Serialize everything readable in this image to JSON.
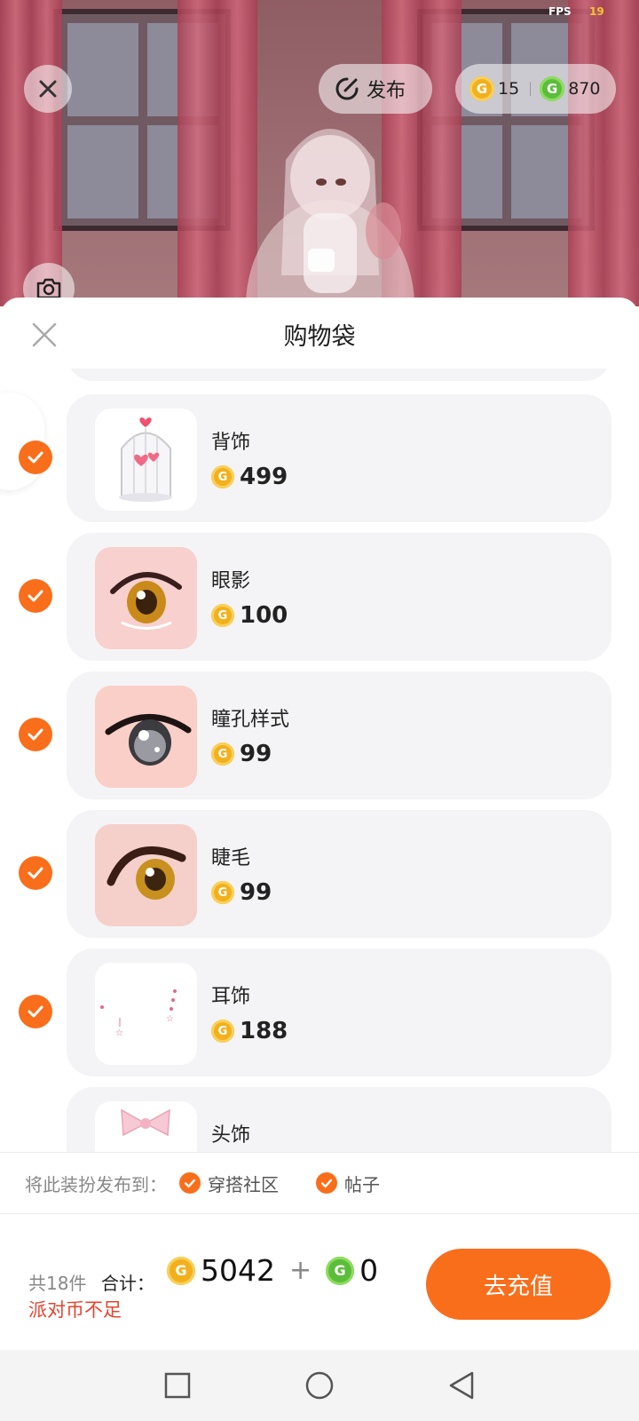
{
  "scene": {
    "fps_label": "FPS",
    "fps_value": "19",
    "publish_label": "发布",
    "gold_coins": "15",
    "green_coins": "870"
  },
  "sheet": {
    "title": "购物袋",
    "items": [
      {
        "name": "背饰",
        "price": "499",
        "currency": "gold",
        "selected": true
      },
      {
        "name": "眼影",
        "price": "100",
        "currency": "gold",
        "selected": true
      },
      {
        "name": "瞳孔样式",
        "price": "99",
        "currency": "gold",
        "selected": true
      },
      {
        "name": "睫毛",
        "price": "99",
        "currency": "gold",
        "selected": true
      },
      {
        "name": "耳饰",
        "price": "188",
        "currency": "gold",
        "selected": true
      },
      {
        "name": "头饰",
        "price": "",
        "currency": "gold",
        "selected": true
      }
    ]
  },
  "publish_to": {
    "label": "将此装扮发布到：",
    "options": [
      {
        "label": "穿搭社区",
        "checked": true
      },
      {
        "label": "帖子",
        "checked": true
      }
    ]
  },
  "total": {
    "count_label": "共18件",
    "sum_label": "合计：",
    "gold_total": "5042",
    "plus": "+",
    "green_total": "0",
    "warning": "派对币不足",
    "recharge_label": "去充值"
  },
  "colors": {
    "accent": "#f96e1b",
    "warning": "#e4442f",
    "gold_coin": "#f2b01d",
    "green_coin": "#5bbd3a",
    "card_bg": "#f4f4f6"
  }
}
